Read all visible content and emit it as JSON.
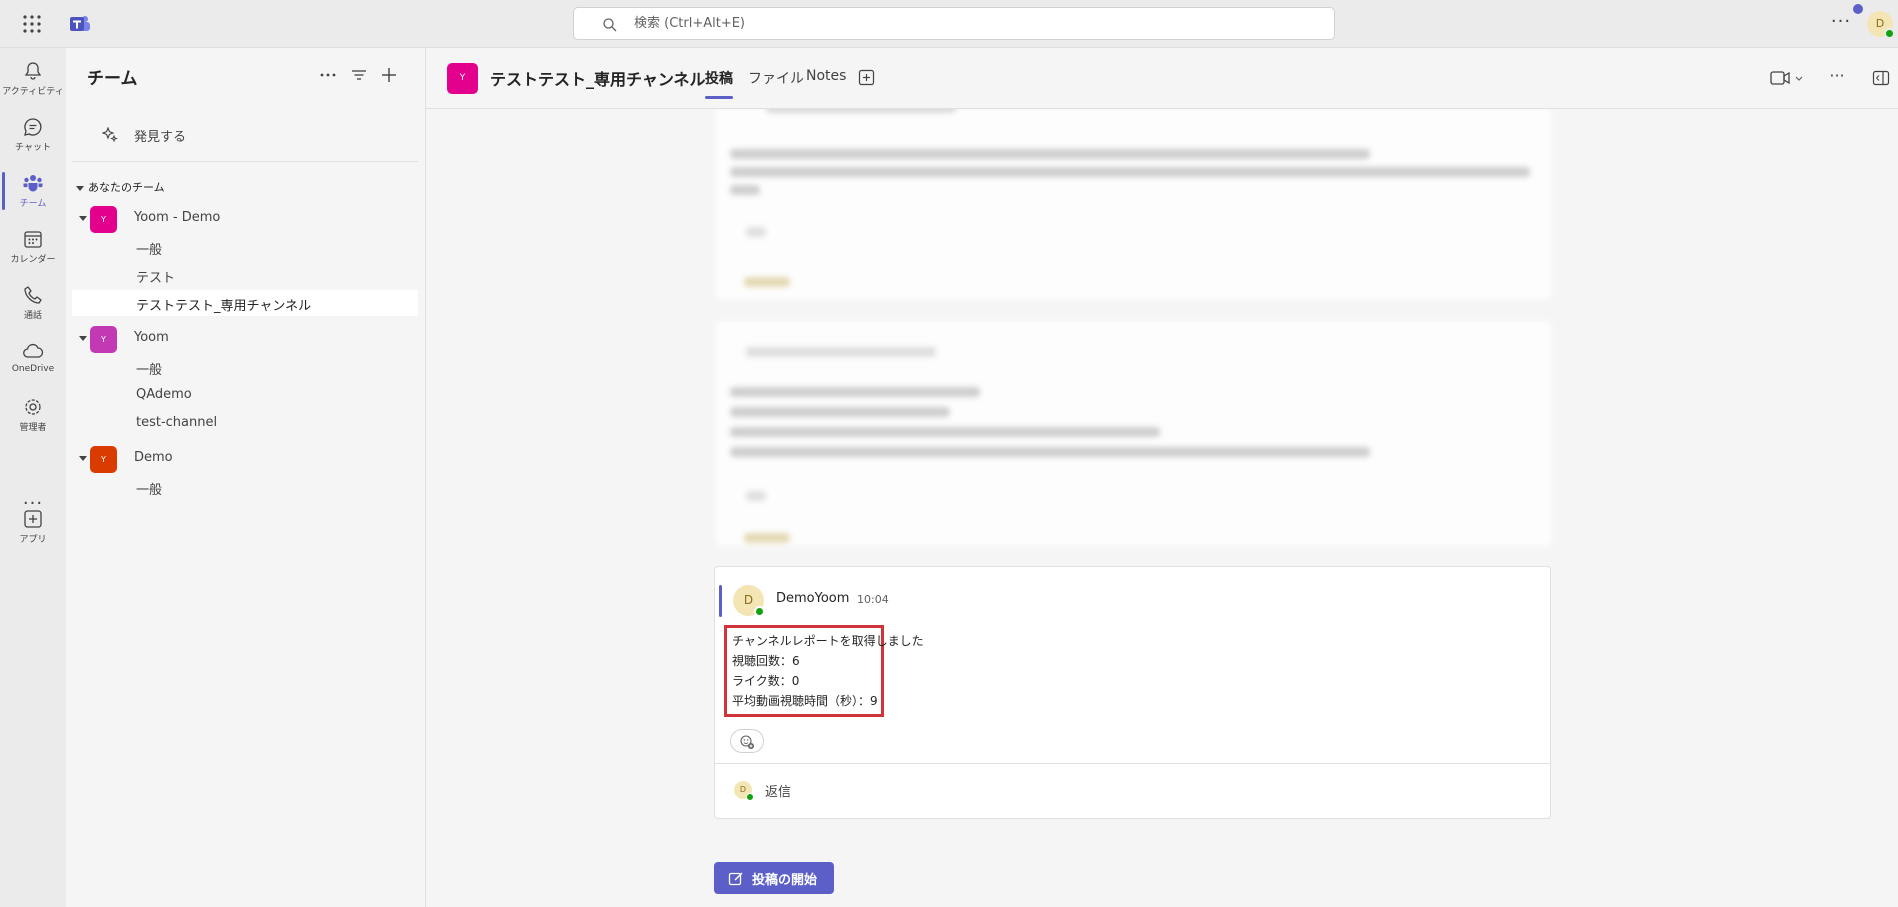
{
  "search": {
    "placeholder": "検索 (Ctrl+Alt+E)"
  },
  "user": {
    "initial": "D"
  },
  "rail": {
    "items": [
      {
        "label": "アクティビティ",
        "icon": "bell-icon"
      },
      {
        "label": "チャット",
        "icon": "chat-icon"
      },
      {
        "label": "チーム",
        "icon": "teams-icon"
      },
      {
        "label": "カレンダー",
        "icon": "calendar-icon"
      },
      {
        "label": "通話",
        "icon": "phone-icon"
      },
      {
        "label": "OneDrive",
        "icon": "cloud-icon"
      },
      {
        "label": "管理者",
        "icon": "admin-icon"
      },
      {
        "label": "アプリ",
        "icon": "apps-icon"
      }
    ],
    "more": "···"
  },
  "panel": {
    "title": "チーム",
    "discover": "発見する",
    "section": "あなたのチーム",
    "teams": [
      {
        "name": "Yoom - Demo",
        "avatar": "Y",
        "color": "#e3008c",
        "channels": [
          "一般",
          "テスト",
          "テストテスト_専用チャンネル"
        ]
      },
      {
        "name": "Yoom",
        "avatar": "Y",
        "color": "#c239b3",
        "channels": [
          "一般",
          "QAdemo",
          "test-channel"
        ]
      },
      {
        "name": "Demo",
        "avatar": "Y",
        "color": "#da3b01",
        "channels": [
          "一般"
        ]
      }
    ]
  },
  "channel": {
    "avatar": "Y",
    "name": "テストテスト_専用チャンネル",
    "tabs": [
      "投稿",
      "ファイル",
      "Notes"
    ]
  },
  "post": {
    "author": "DemoYoom",
    "avatar": "D",
    "time": "10:04",
    "lines": [
      "チャンネルレポートを取得しました",
      "視聴回数：6",
      "ライク数：0",
      "平均動画視聴時間（秒）：9"
    ],
    "reply": "返信"
  },
  "new_post": "投稿の開始",
  "colors": {
    "brand": "#5b5fc7",
    "highlight": "#d13438",
    "presence": "#13a10e"
  }
}
